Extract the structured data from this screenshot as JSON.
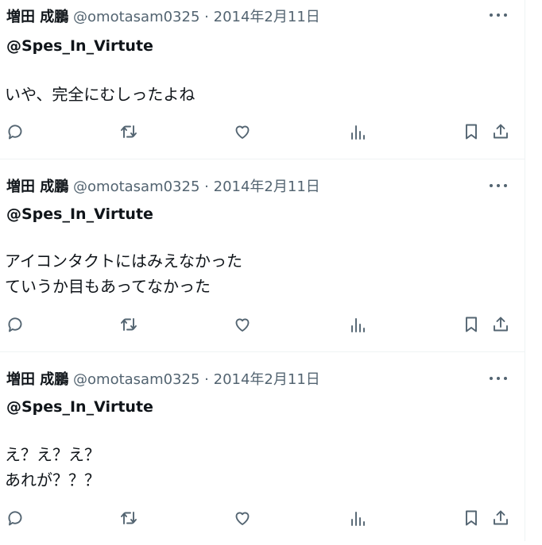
{
  "tweets": [
    {
      "display_name": "増田 成鵬",
      "handle": "@omotasam0325",
      "separator": "·",
      "date": "2014年2月11日",
      "reply_to": "@Spes_In_Virtute",
      "text": "いや、完全にむしったよね"
    },
    {
      "display_name": "増田 成鵬",
      "handle": "@omotasam0325",
      "separator": "·",
      "date": "2014年2月11日",
      "reply_to": "@Spes_In_Virtute",
      "text": "アイコンタクトにはみえなかった\nていうか目もあってなかった"
    },
    {
      "display_name": "増田 成鵬",
      "handle": "@omotasam0325",
      "separator": "·",
      "date": "2014年2月11日",
      "reply_to": "@Spes_In_Virtute",
      "text": "え？え？え？\nあれが？？？"
    }
  ],
  "icons": {
    "more": "more-dots-icon",
    "reply": "reply-icon",
    "retweet": "retweet-icon",
    "like": "heart-icon",
    "views": "views-bar-icon",
    "bookmark": "bookmark-icon",
    "share": "share-icon"
  },
  "colors": {
    "text": "#0f1419",
    "secondary": "#536471",
    "border": "#eff3f4"
  }
}
